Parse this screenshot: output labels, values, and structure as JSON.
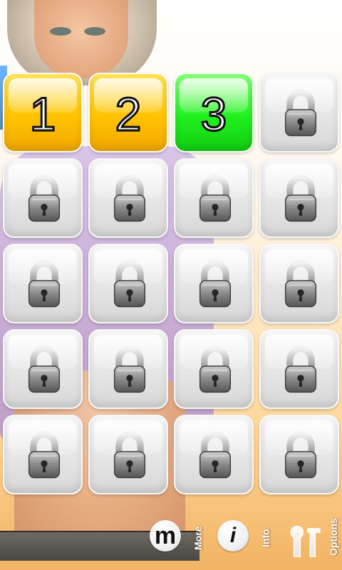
{
  "level_grid": {
    "rows": 5,
    "cols": 4,
    "tiles": [
      {
        "label": "1",
        "state": "unlocked",
        "style": "yellow"
      },
      {
        "label": "2",
        "state": "unlocked",
        "style": "yellow"
      },
      {
        "label": "3",
        "state": "current",
        "style": "green"
      },
      {
        "label": "",
        "state": "locked",
        "style": "locked"
      },
      {
        "label": "",
        "state": "locked",
        "style": "locked"
      },
      {
        "label": "",
        "state": "locked",
        "style": "locked"
      },
      {
        "label": "",
        "state": "locked",
        "style": "locked"
      },
      {
        "label": "",
        "state": "locked",
        "style": "locked"
      },
      {
        "label": "",
        "state": "locked",
        "style": "locked"
      },
      {
        "label": "",
        "state": "locked",
        "style": "locked"
      },
      {
        "label": "",
        "state": "locked",
        "style": "locked"
      },
      {
        "label": "",
        "state": "locked",
        "style": "locked"
      },
      {
        "label": "",
        "state": "locked",
        "style": "locked"
      },
      {
        "label": "",
        "state": "locked",
        "style": "locked"
      },
      {
        "label": "",
        "state": "locked",
        "style": "locked"
      },
      {
        "label": "",
        "state": "locked",
        "style": "locked"
      },
      {
        "label": "",
        "state": "locked",
        "style": "locked"
      },
      {
        "label": "",
        "state": "locked",
        "style": "locked"
      },
      {
        "label": "",
        "state": "locked",
        "style": "locked"
      },
      {
        "label": "",
        "state": "locked",
        "style": "locked"
      }
    ]
  },
  "bottom_menu": {
    "more": {
      "label": "More",
      "icon": "m-circle-icon",
      "glyph": "m"
    },
    "info": {
      "label": "Info",
      "icon": "info-icon",
      "glyph": "i"
    },
    "options": {
      "label": "Options",
      "icon": "tools-icon"
    }
  },
  "colors": {
    "tile_yellow": "#ffc300",
    "tile_green": "#20f11e",
    "tile_locked": "#e7e7e7"
  }
}
